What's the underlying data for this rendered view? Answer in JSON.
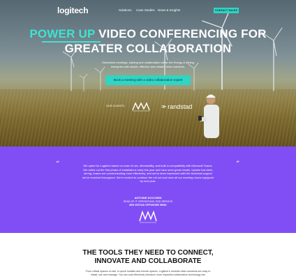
{
  "nav": {
    "logo": "logitech",
    "items": [
      "Solutions",
      "Case Studies",
      "News & Insights"
    ],
    "cta_label": "CONTACT SALES"
  },
  "hero": {
    "headline_accent": "POWER UP",
    "headline_line1_rest": " VIDEO CONFERENCING FOR",
    "headline_line2": "GREATER COLLABORATION",
    "subcopy": "Streamline meetings, training and collaboration within the Energy & Mining enterprise with simple, effective and reliable video solutions.",
    "cta_label": "Book a meeting with a video collaboration expert",
    "clients_label": "OUR CLIENTS:",
    "client_logo_text": "randstad",
    "accent_color": "#3ee3d3"
  },
  "testimonial": {
    "quote": "We opted for Logitech based on ease of use, affordability, and built-in compatibility with Microsoft Teams. We rolled out the first phase of installations early this year and have seen great results. Uptake has been strong, teams are communicating more effectively, and we've been impressed with the technical support we've received throughout. We're excited to continue the roll out and have all our meeting rooms equipped by next year.",
    "author_name": "ANTOINE DOCOWIN",
    "author_title": "HEAD OF IT OPERATIONS, END SERVICE",
    "author_company": "MHI VESTAS OFFSHORE WIND",
    "background_color": "#814ef5"
  },
  "tools": {
    "title_line1": "THE TOOLS THEY NEED TO CONNECT,",
    "title_line2": "INNOVATE AND COLLABORATE",
    "copy": "From critical spaces on site, to quick huddles and remote spaces, Logitech's modular video solutions are easy to install, use and manage. You can cost effectively introduce more impactful collaboration technology into"
  }
}
